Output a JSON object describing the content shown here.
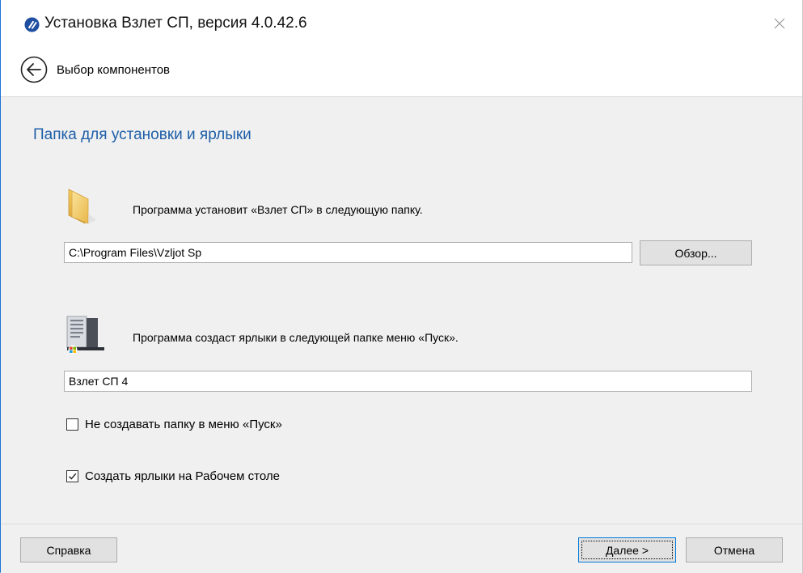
{
  "window": {
    "title": "Установка Взлет СП, версия 4.0.42.6",
    "app_icon": "vzlet-logo-icon",
    "close_icon": "close-icon",
    "accent_color": "#1e73d6"
  },
  "nav": {
    "back_icon": "back-arrow-icon",
    "label": "Выбор компонентов"
  },
  "page": {
    "section_title": "Папка для установки и ярлыки",
    "install_folder": {
      "icon": "folder-icon",
      "description": "Программа установит «Взлет СП» в следующую папку.",
      "path_value": "C:\\Program Files\\Vzljot Sp",
      "browse_label": "Обзор..."
    },
    "start_menu": {
      "icon": "start-menu-folder-icon",
      "description": "Программа создаст ярлыки в следующей папке меню «Пуск».",
      "folder_value": "Взлет СП 4"
    },
    "options": [
      {
        "label": "Не создавать папку в меню «Пуск»",
        "checked": false
      },
      {
        "label": "Создать ярлыки на Рабочем столе",
        "checked": true
      }
    ]
  },
  "footer": {
    "help_label": "Справка",
    "next_label": "Далее >",
    "cancel_label": "Отмена"
  }
}
